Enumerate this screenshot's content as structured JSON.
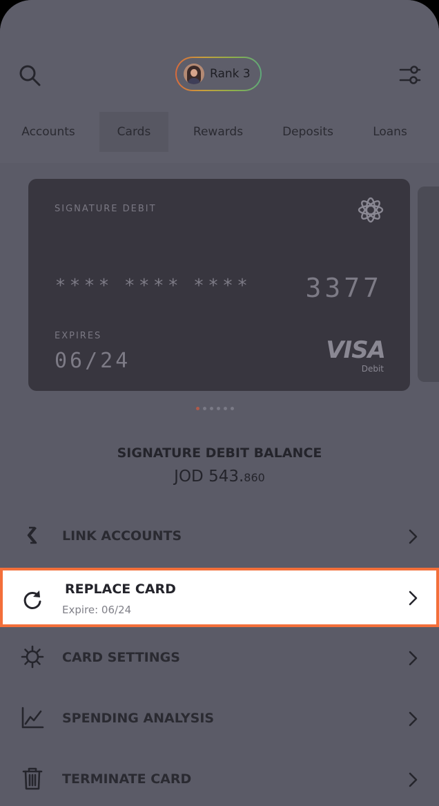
{
  "header": {
    "rank_label": "Rank 3",
    "tabs": [
      {
        "label": "Accounts"
      },
      {
        "label": "Cards"
      },
      {
        "label": "Rewards"
      },
      {
        "label": "Deposits"
      },
      {
        "label": "Loans"
      }
    ],
    "active_tab": "Cards"
  },
  "card": {
    "type_label": "SIGNATURE DEBIT",
    "masked_groups": "**** **** ****",
    "last4": "3377",
    "expires_label": "EXPIRES",
    "expiry": "06/24",
    "brand": "VISA",
    "brand_sub": "Debit"
  },
  "carousel": {
    "count": 6,
    "active_index": 0
  },
  "balance": {
    "title": "SIGNATURE DEBIT BALANCE",
    "currency_int": "JOD 543.",
    "decimals": "860"
  },
  "actions": [
    {
      "label": "LINK ACCOUNTS",
      "icon": "link-icon"
    },
    {
      "label": "REPLACE CARD",
      "sublabel": "Expire: 06/24",
      "icon": "refresh-icon",
      "highlighted": true
    },
    {
      "label": "CARD SETTINGS",
      "icon": "gear-icon"
    },
    {
      "label": "SPENDING ANALYSIS",
      "icon": "chart-icon"
    },
    {
      "label": "TERMINATE CARD",
      "icon": "trash-icon"
    }
  ],
  "colors": {
    "highlight_border": "#f36f3a",
    "overlay_bg": "#5b5b67",
    "card_bg": "#38363f"
  }
}
